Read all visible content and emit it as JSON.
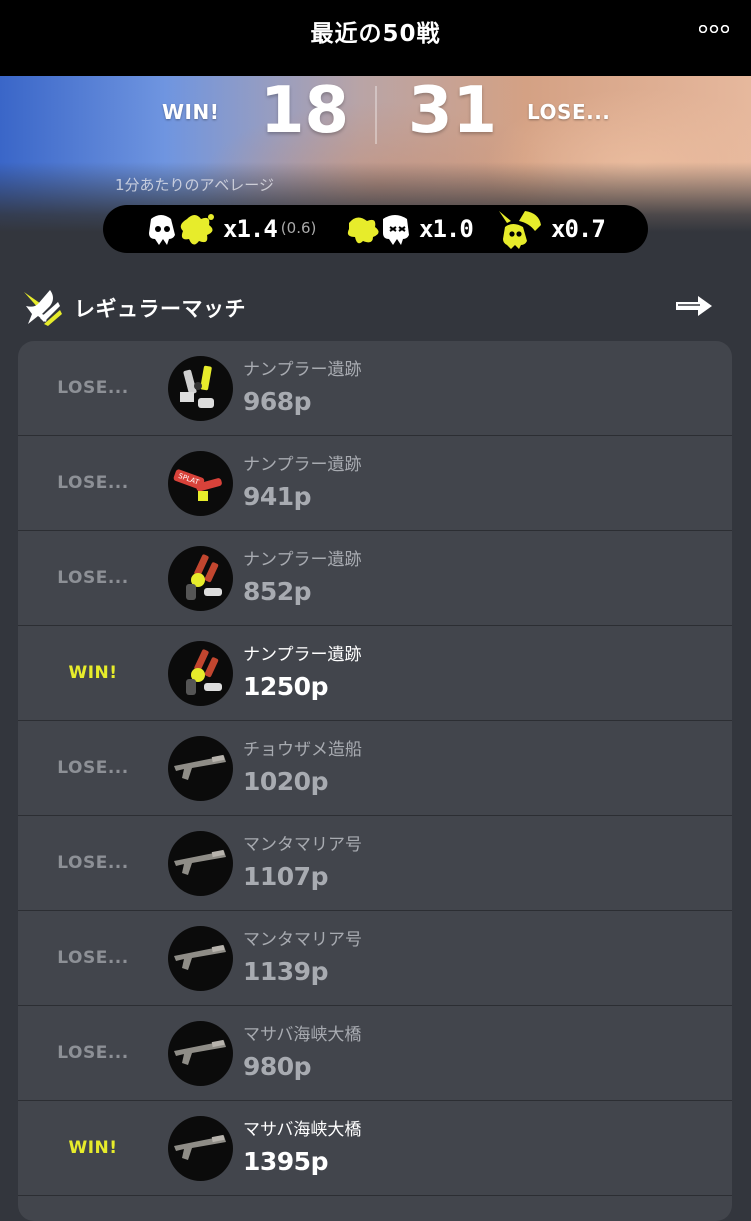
{
  "header": {
    "title": "最近の50戦"
  },
  "summary": {
    "win_label": "WIN!",
    "wins": "18",
    "lose_label": "LOSE...",
    "losses": "31",
    "avg_label": "1分あたりのアベレージ",
    "kills": "x1.4",
    "assists": "(0.6)",
    "deaths": "x1.0",
    "specials": "x0.7"
  },
  "section": {
    "title": "レギュラーマッチ"
  },
  "matches": [
    {
      "result": "LOSE...",
      "stage": "ナンプラー遺跡",
      "power": "968p",
      "win": false,
      "weapon_icon": "splash-o-matic-icon"
    },
    {
      "result": "LOSE...",
      "stage": "ナンプラー遺跡",
      "power": "941p",
      "win": false,
      "weapon_icon": "splash-o-matic-red-icon"
    },
    {
      "result": "LOSE...",
      "stage": "ナンプラー遺跡",
      "power": "852p",
      "win": false,
      "weapon_icon": "dapple-dualies-icon"
    },
    {
      "result": "WIN!",
      "stage": "ナンプラー遺跡",
      "power": "1250p",
      "win": true,
      "weapon_icon": "dapple-dualies-icon"
    },
    {
      "result": "LOSE...",
      "stage": "チョウザメ造船",
      "power": "1020p",
      "win": false,
      "weapon_icon": "squiffer-icon"
    },
    {
      "result": "LOSE...",
      "stage": "マンタマリア号",
      "power": "1107p",
      "win": false,
      "weapon_icon": "squiffer-icon"
    },
    {
      "result": "LOSE...",
      "stage": "マンタマリア号",
      "power": "1139p",
      "win": false,
      "weapon_icon": "squiffer-icon"
    },
    {
      "result": "LOSE...",
      "stage": "マサバ海峡大橋",
      "power": "980p",
      "win": false,
      "weapon_icon": "squiffer-icon"
    },
    {
      "result": "WIN!",
      "stage": "マサバ海峡大橋",
      "power": "1395p",
      "win": true,
      "weapon_icon": "squiffer-icon"
    }
  ],
  "colors": {
    "win": "#e7ec2b",
    "lose": "#8d9096",
    "panel": "#42454c",
    "background": "#33363d"
  }
}
